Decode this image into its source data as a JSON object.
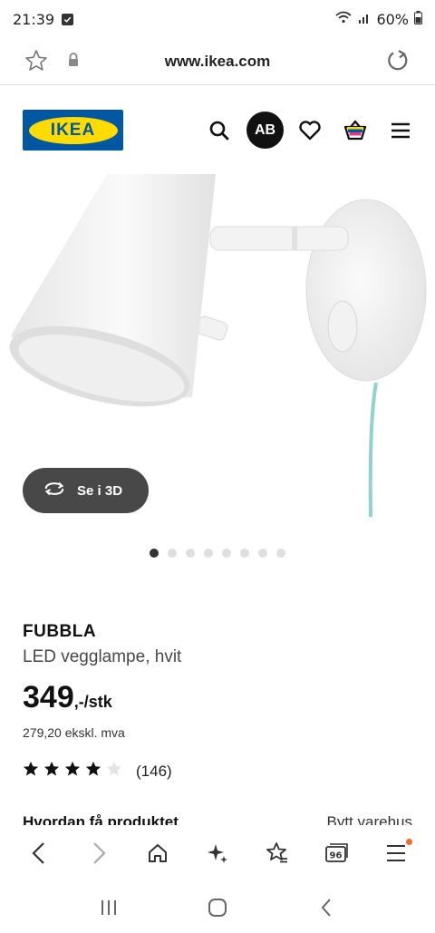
{
  "status_bar": {
    "time": "21:39",
    "battery": "60%"
  },
  "browser": {
    "url": "www.ikea.com"
  },
  "site": {
    "logo_text": "IKEA",
    "avatar_initials": "AB",
    "brand_blue": "#0058a3",
    "brand_yellow": "#ffdb00"
  },
  "product": {
    "view_3d_label": "Se i 3D",
    "image_count": 8,
    "active_image": 1,
    "name": "FUBBLA",
    "description": "LED vegglampe, hvit",
    "price_main": "349",
    "price_suffix": ",-/stk",
    "price_ex_vat": "279,20 ekskl. mva",
    "rating_value": 4,
    "rating_max": 5,
    "review_count": "(146)",
    "section_left": "Hvordan få produktet",
    "section_right": "Bytt varehus"
  },
  "browser_nav": {
    "tabs_count": "96"
  }
}
